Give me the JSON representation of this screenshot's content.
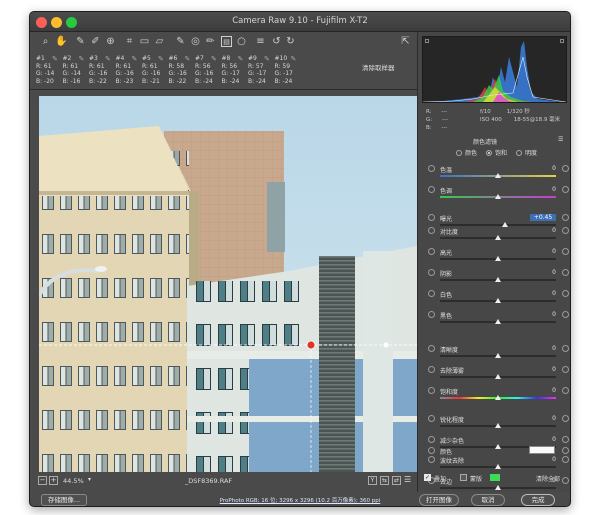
{
  "window": {
    "title": "Camera Raw 9.10  -  Fujifilm X-T2"
  },
  "toolbar": {
    "tools": [
      "zoom-icon",
      "hand-icon",
      "white-balance-icon",
      "color-sampler-icon",
      "targeted-adjustment-icon",
      "crop-icon",
      "straighten-icon",
      "transform-icon",
      "spot-removal-icon",
      "red-eye-icon",
      "adjustment-brush-icon",
      "graduated-filter-icon",
      "radial-filter-icon",
      "preferences-icon",
      "rotate-ccw-icon",
      "rotate-cw-icon"
    ],
    "open_icon": "open-in-photoshop-icon"
  },
  "samplers": {
    "items": [
      {
        "id": "#1",
        "r": "61",
        "g": "-14",
        "b": "-20"
      },
      {
        "id": "#2",
        "r": "61",
        "g": "-14",
        "b": "-16"
      },
      {
        "id": "#3",
        "r": "61",
        "g": "-16",
        "b": "-22"
      },
      {
        "id": "#4",
        "r": "61",
        "g": "-16",
        "b": "-23"
      },
      {
        "id": "#5",
        "r": "61",
        "g": "-16",
        "b": "-21"
      },
      {
        "id": "#6",
        "r": "58",
        "g": "-16",
        "b": "-22"
      },
      {
        "id": "#7",
        "r": "56",
        "g": "-16",
        "b": "-24"
      },
      {
        "id": "#8",
        "r": "56",
        "g": "-17",
        "b": "-24"
      },
      {
        "id": "#9",
        "r": "57",
        "g": "-17",
        "b": "-24"
      },
      {
        "id": "#10",
        "r": "59",
        "g": "-17",
        "b": "-24"
      }
    ],
    "clear_label": "清除取样器"
  },
  "status": {
    "zoom": "44.5%",
    "filename": "_DSF8369.RAF"
  },
  "info": {
    "r": "R:",
    "g": "G:",
    "b": "B:",
    "r_val": "---",
    "g_val": "---",
    "b_val": "---",
    "aperture": "f/10",
    "shutter": "1/320 秒",
    "iso": "ISO 400",
    "lens": "18-55@18.9 毫米"
  },
  "panel": {
    "section": "颜色滤镜",
    "modes": [
      "颜色",
      "饱和",
      "明度"
    ],
    "active_mode": 1,
    "sliders": [
      {
        "label": "色温",
        "value": "0",
        "pos": 0.5,
        "gradient": "temp"
      },
      {
        "label": "色调",
        "value": "0",
        "pos": 0.5,
        "gradient": "tint"
      },
      {
        "label": "曝光",
        "value": "+0.45",
        "pos": 0.56,
        "highlight": true
      },
      {
        "label": "对比度",
        "value": "0",
        "pos": 0.5
      },
      {
        "label": "高光",
        "value": "0",
        "pos": 0.5
      },
      {
        "label": "阴影",
        "value": "0",
        "pos": 0.5
      },
      {
        "label": "白色",
        "value": "0",
        "pos": 0.5
      },
      {
        "label": "黑色",
        "value": "0",
        "pos": 0.5
      },
      {
        "label": "清晰度",
        "value": "0",
        "pos": 0.5
      },
      {
        "label": "去除薄雾",
        "value": "0",
        "pos": 0.5
      },
      {
        "label": "饱和度",
        "value": "0",
        "pos": 0.5,
        "gradient": "sat"
      },
      {
        "label": "锐化程度",
        "value": "0",
        "pos": 0.5
      },
      {
        "label": "减少杂色",
        "value": "0",
        "pos": 0.5
      },
      {
        "label": "波纹去除",
        "value": "0",
        "pos": 0.5
      },
      {
        "label": "去边",
        "value": "0",
        "pos": 0.5
      }
    ],
    "color_label": "颜色",
    "overlay_label": "叠加",
    "mask_label": "蒙版",
    "clear_all": "清除全部"
  },
  "bottom": {
    "save": "存储图像...",
    "info": "ProPhoto RGB; 16 位; 3296 x 3296 (10.2 百万像素); 360 ppi",
    "open": "打开图像",
    "cancel": "取消",
    "done": "完成"
  },
  "colors": {
    "accent": "#3d6fb6",
    "mask_green": "#3ddc56",
    "close": "#fc5f57",
    "min": "#fdbc2e",
    "max": "#28c840"
  }
}
